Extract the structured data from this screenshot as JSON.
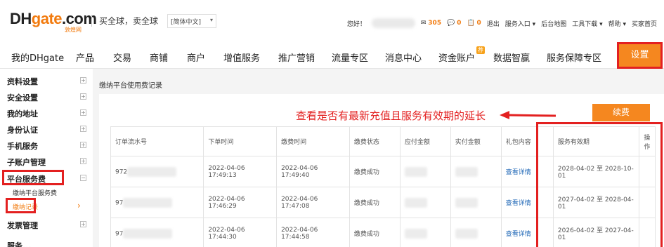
{
  "header": {
    "logo_main": "DH",
    "logo_accent": "gate",
    "logo_suffix": ".com",
    "logo_sub": "敦煌网",
    "slogan": "买全球，卖全球",
    "lang_select": "[简体中文]",
    "greeting": "您好！",
    "mail_count": "305",
    "msg_count": "0",
    "notice_count": "0",
    "links": [
      "退出",
      "服务入口 ▾",
      "后台地图",
      "工具下载 ▾",
      "帮助 ▾",
      "买家首页"
    ]
  },
  "nav": {
    "items": [
      "我的DHgate",
      "产品",
      "交易",
      "商铺",
      "商户",
      "增值服务",
      "推广营销",
      "流量专区",
      "消息中心",
      "资金账户",
      "数据智赢",
      "服务保障专区"
    ],
    "badge": "荐",
    "settings": "设置"
  },
  "sidebar": {
    "items": [
      "资料设置",
      "安全设置",
      "我的地址",
      "身份认证",
      "手机服务",
      "子账户管理",
      "平台服务费",
      "发票管理"
    ],
    "sub_items": [
      "缴纳平台服务费",
      "缴纳记录"
    ],
    "sub_arrow": "›",
    "bottom_cut": "服务..."
  },
  "main": {
    "title": "缴纳平台使用费记录",
    "annotation": "查看是否有最新充值且服务有效期的延长",
    "renew_button": "续费",
    "columns": [
      "订单流水号",
      "下单时间",
      "缴费时间",
      "缴费状态",
      "应付金额",
      "实付金额",
      "礼包内容",
      "服务有效期",
      "操作"
    ],
    "rows": [
      {
        "order": "972",
        "order_time": "2022-04-06 17:49:13",
        "pay_time": "2022-04-06 17:49:40",
        "status": "缴费成功",
        "detail": "查看详情",
        "validity": "2028-04-02 至 2028-10-01"
      },
      {
        "order": "97",
        "order_time": "2022-04-06 17:46:29",
        "pay_time": "2022-04-06 17:47:08",
        "status": "缴费成功",
        "detail": "查看详情",
        "validity": "2027-04-02 至 2028-04-01"
      },
      {
        "order": "97",
        "order_time": "2022-04-06 17:44:30",
        "pay_time": "2022-04-06 17:44:58",
        "status": "缴费成功",
        "detail": "查看详情",
        "validity": "2026-04-02 至 2027-04-01"
      }
    ]
  },
  "colors": {
    "accent": "#f5871f",
    "highlight": "#e32020",
    "link": "#1b64b5"
  }
}
